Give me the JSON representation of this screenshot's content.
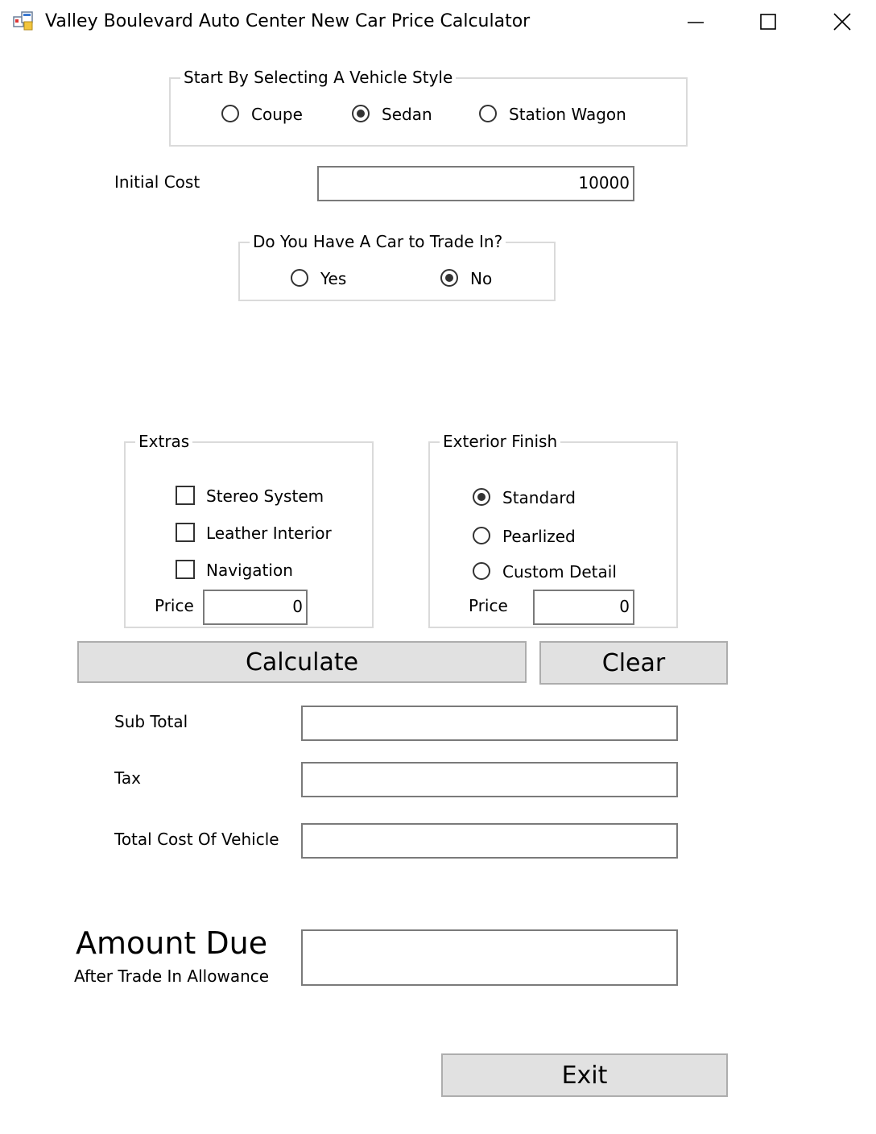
{
  "window": {
    "title": "Valley Boulevard Auto Center New Car Price Calculator"
  },
  "vehicle_style": {
    "legend": "Start By Selecting A Vehicle Style",
    "options": [
      {
        "label": "Coupe",
        "checked": false
      },
      {
        "label": "Sedan",
        "checked": true
      },
      {
        "label": "Station Wagon",
        "checked": false
      }
    ]
  },
  "initial_cost": {
    "label": "Initial Cost",
    "value": "10000"
  },
  "trade_in": {
    "legend": "Do You Have A Car to Trade In?",
    "options": [
      {
        "label": "Yes",
        "checked": false
      },
      {
        "label": "No",
        "checked": true
      }
    ]
  },
  "extras": {
    "legend": "Extras",
    "options": [
      {
        "label": "Stereo System",
        "checked": false
      },
      {
        "label": "Leather Interior",
        "checked": false
      },
      {
        "label": "Navigation",
        "checked": false
      }
    ],
    "price_label": "Price",
    "price_value": "0"
  },
  "exterior_finish": {
    "legend": "Exterior Finish",
    "options": [
      {
        "label": "Standard",
        "checked": true
      },
      {
        "label": "Pearlized",
        "checked": false
      },
      {
        "label": "Custom Detail",
        "checked": false
      }
    ],
    "price_label": "Price",
    "price_value": "0"
  },
  "buttons": {
    "calculate": "Calculate",
    "clear": "Clear",
    "exit": "Exit"
  },
  "results": {
    "sub_total_label": "Sub Total",
    "sub_total_value": "",
    "tax_label": "Tax",
    "tax_value": "",
    "total_label": "Total Cost Of Vehicle",
    "total_value": "",
    "amount_due_label": "Amount Due",
    "amount_due_sublabel": "After Trade In Allowance",
    "amount_due_value": ""
  }
}
